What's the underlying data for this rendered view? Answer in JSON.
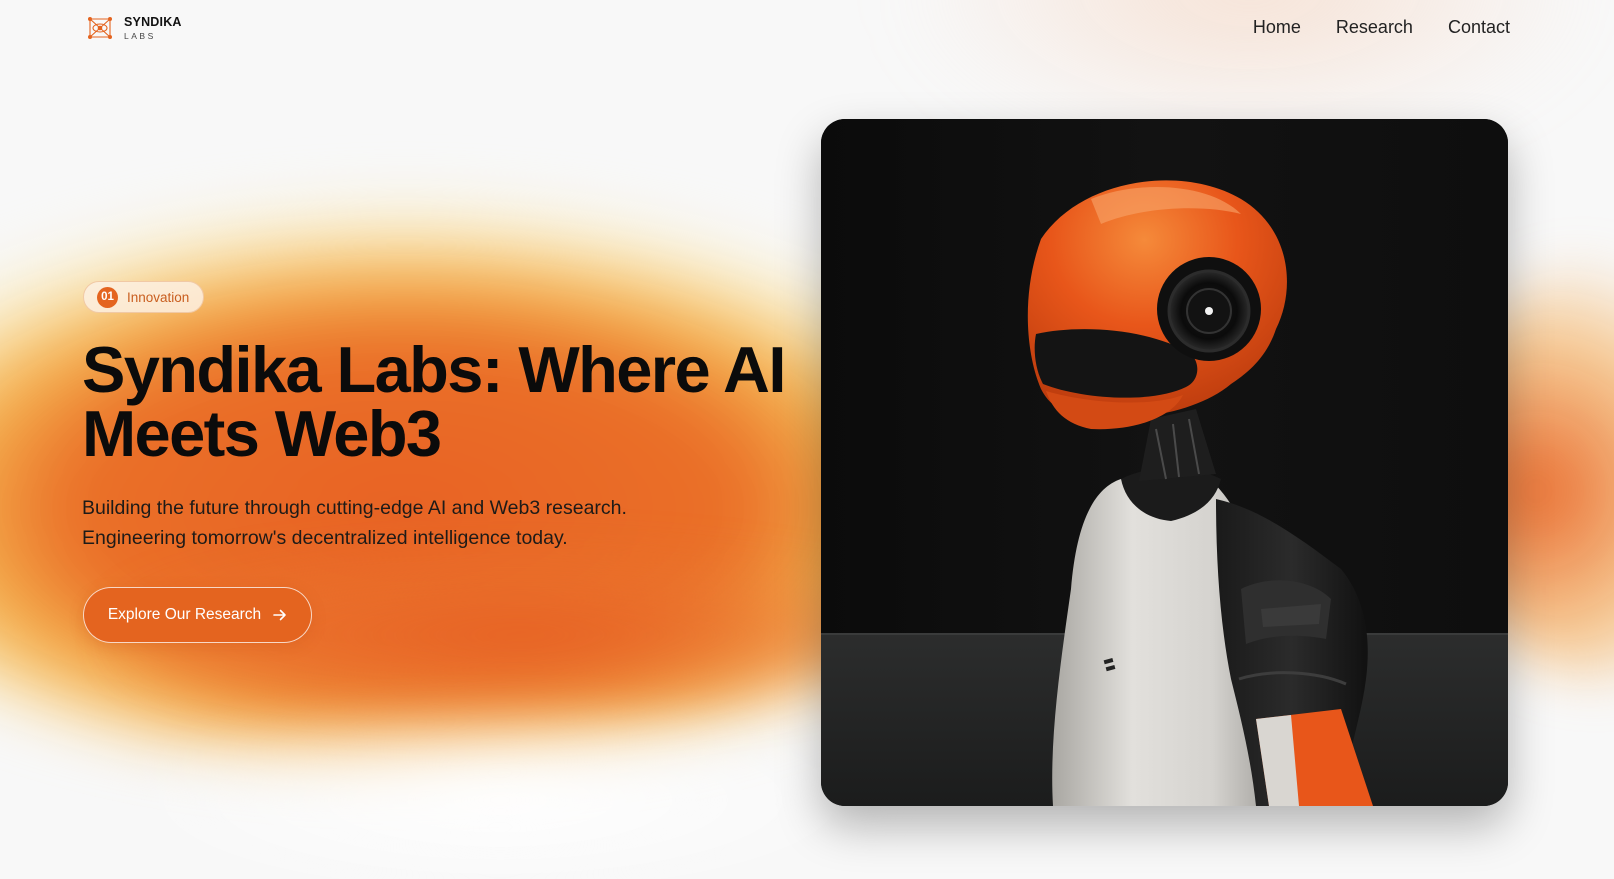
{
  "brand": {
    "name": "SYNDIKA",
    "sub": "LABS",
    "logo_icon": "network-nodes-icon",
    "accent": "#e4641f"
  },
  "nav": {
    "items": [
      {
        "label": "Home"
      },
      {
        "label": "Research"
      },
      {
        "label": "Contact"
      }
    ]
  },
  "hero": {
    "badge": {
      "number": "01",
      "label": "Innovation"
    },
    "headline": "Syndika Labs: Where AI Meets Web3",
    "subtext": "Building the future through cutting-edge AI and Web3 research. Engineering tomorrow's decentralized intelligence today.",
    "cta": {
      "label": "Explore Our Research",
      "icon": "arrow-right-icon"
    }
  },
  "image": {
    "subject": "humanoid robot with orange helmet",
    "colors": {
      "helmet": "#e8561a",
      "body": "#dcdad6",
      "background": "#0d0d0d"
    }
  }
}
